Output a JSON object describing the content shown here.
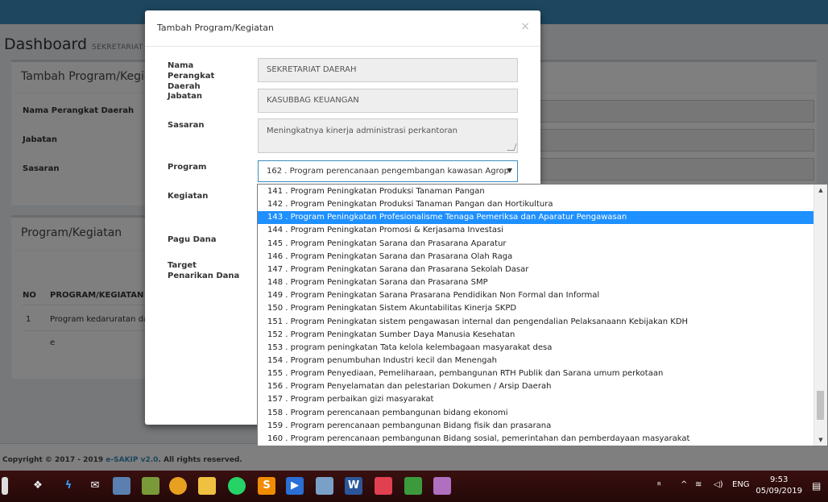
{
  "background": {
    "dashboard_title": "Dashboard",
    "dashboard_subtitle": "SEKRETARIAT D",
    "box1_title": "Tambah Program/Kegiata",
    "box1_fields": [
      "Nama Perangkat Daerah",
      "Jabatan",
      "Sasaran"
    ],
    "box2_title": "Program/Kegiatan",
    "table_headers": [
      "NO",
      "PROGRAM/KEGIATAN"
    ],
    "rows": [
      {
        "no": "1",
        "program": "Program kedaruratan da"
      },
      {
        "no": "",
        "program": "e"
      }
    ],
    "footer_prefix": "Copyright © 2017 - 2019 ",
    "footer_link": "e-SAKIP v2.0",
    "footer_suffix": ". All rights reserved."
  },
  "modal": {
    "title": "Tambah Program/Kegiatan",
    "close": "×",
    "labels": {
      "nama": "Nama Perangkat Daerah",
      "jabatan": "Jabatan",
      "sasaran": "Sasaran",
      "program": "Program",
      "kegiatan": "Kegiatan",
      "pagu": "Pagu Dana",
      "target": "Target Penarikan Dana"
    },
    "values": {
      "nama": "SEKRETARIAT DAERAH",
      "jabatan": "KASUBBAG KEUANGAN",
      "sasaran": "Meningkatnya kinerja administrasi perkantoran",
      "program_selected": "162 . Program perencanaan pengembangan kawasan Agrop"
    }
  },
  "dropdown": {
    "selected_index": 2,
    "options": [
      "141 . Program Peningkatan Produksi Tanaman Pangan",
      "142 . Program Peningkatan Produksi Tanaman Pangan dan Hortikultura",
      "143 . Program Peningkatan Profesionalisme Tenaga Pemeriksa dan Aparatur Pengawasan",
      "144 . Program Peningkatan Promosi & Kerjasama Investasi",
      "145 . Program Peningkatan Sarana dan Prasarana Aparatur",
      "146 . Program Peningkatan Sarana dan Prasarana Olah Raga",
      "147 . Program Peningkatan Sarana dan Prasarana Sekolah Dasar",
      "148 . Program Peningkatan Sarana dan Prasarana SMP",
      "149 . Program Peningkatan Sarana Prasarana Pendidikan Non Formal dan Informal",
      "150 . Program Peningkatan Sistem Akuntabilitas Kinerja SKPD",
      "151 . Program Peningkatan sistem pengawasan internal dan pengendalian Pelaksanaann Kebijakan KDH",
      "152 . Program Peningkatan Sumber Daya Manusia Kesehatan",
      "153 . program peningkatan Tata kelola kelembagaan masyarakat desa",
      "154 . Program penumbuhan Industri kecil dan Menengah",
      "155 . Program Penyediaan, Pemeliharaan, pembangunan RTH Publik dan Sarana umum perkotaan",
      "156 . Program Penyelamatan dan pelestarian Dokumen / Arsip Daerah",
      "157 . Program perbaikan gizi masyarakat",
      "158 . Program perencanaan pembangunan bidang ekonomi",
      "159 . Program perencanaan pembangunan Bidang fisik dan prasarana",
      "160 . Program perencanaan pembangunan Bidang sosial, pemerintahan dan pemberdayaan masyarakat"
    ]
  },
  "taskbar": {
    "tray_lang": "ENG",
    "time": "9:53",
    "date": "05/09/2019"
  }
}
